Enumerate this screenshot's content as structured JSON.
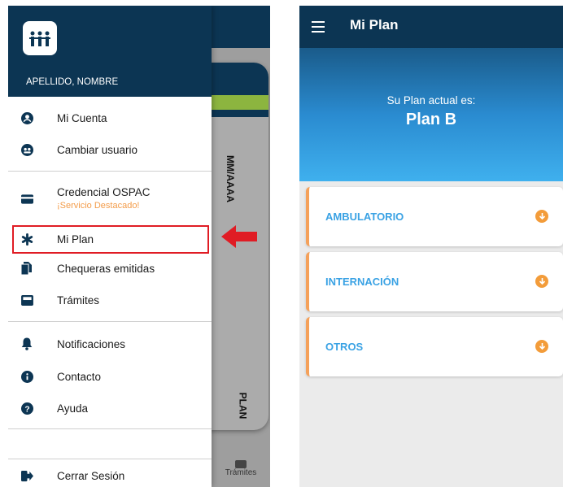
{
  "left": {
    "background": {
      "card_date_text": "MM/AAAA",
      "card_plan_text": "PLAN",
      "bottom_tab_label": "Trámites"
    },
    "drawer": {
      "user_name": "APELLIDO, NOMBRE",
      "items": [
        {
          "label": "Mi Cuenta",
          "icon": "account-circle-icon"
        },
        {
          "label": "Cambiar usuario",
          "icon": "switch-user-icon"
        },
        {
          "label": "Credencial OSPAC",
          "sublabel": "¡Servicio Destacado!",
          "icon": "credit-card-icon"
        },
        {
          "label": "Mi Plan",
          "icon": "asterisk-icon"
        },
        {
          "label": "Chequeras emitidas",
          "icon": "documents-icon"
        },
        {
          "label": "Trámites",
          "icon": "inbox-icon"
        },
        {
          "label": "Notificaciones",
          "icon": "bell-icon"
        },
        {
          "label": "Contacto",
          "icon": "info-icon"
        },
        {
          "label": "Ayuda",
          "icon": "help-icon"
        },
        {
          "label": "Cerrar Sesión",
          "icon": "logout-icon"
        }
      ]
    },
    "annotation": {
      "highlight_color": "#e01c24",
      "arrow_color": "#e01c24"
    }
  },
  "right": {
    "title": "Mi Plan",
    "hero": {
      "subtitle": "Su Plan actual es:",
      "plan": "Plan B"
    },
    "sections": [
      {
        "label": "AMBULATORIO"
      },
      {
        "label": "INTERNACIÓN"
      },
      {
        "label": "OTROS"
      }
    ]
  },
  "colors": {
    "navy": "#0c3553",
    "accent_blue": "#3aa2e4",
    "accent_orange": "#f39c3a"
  }
}
